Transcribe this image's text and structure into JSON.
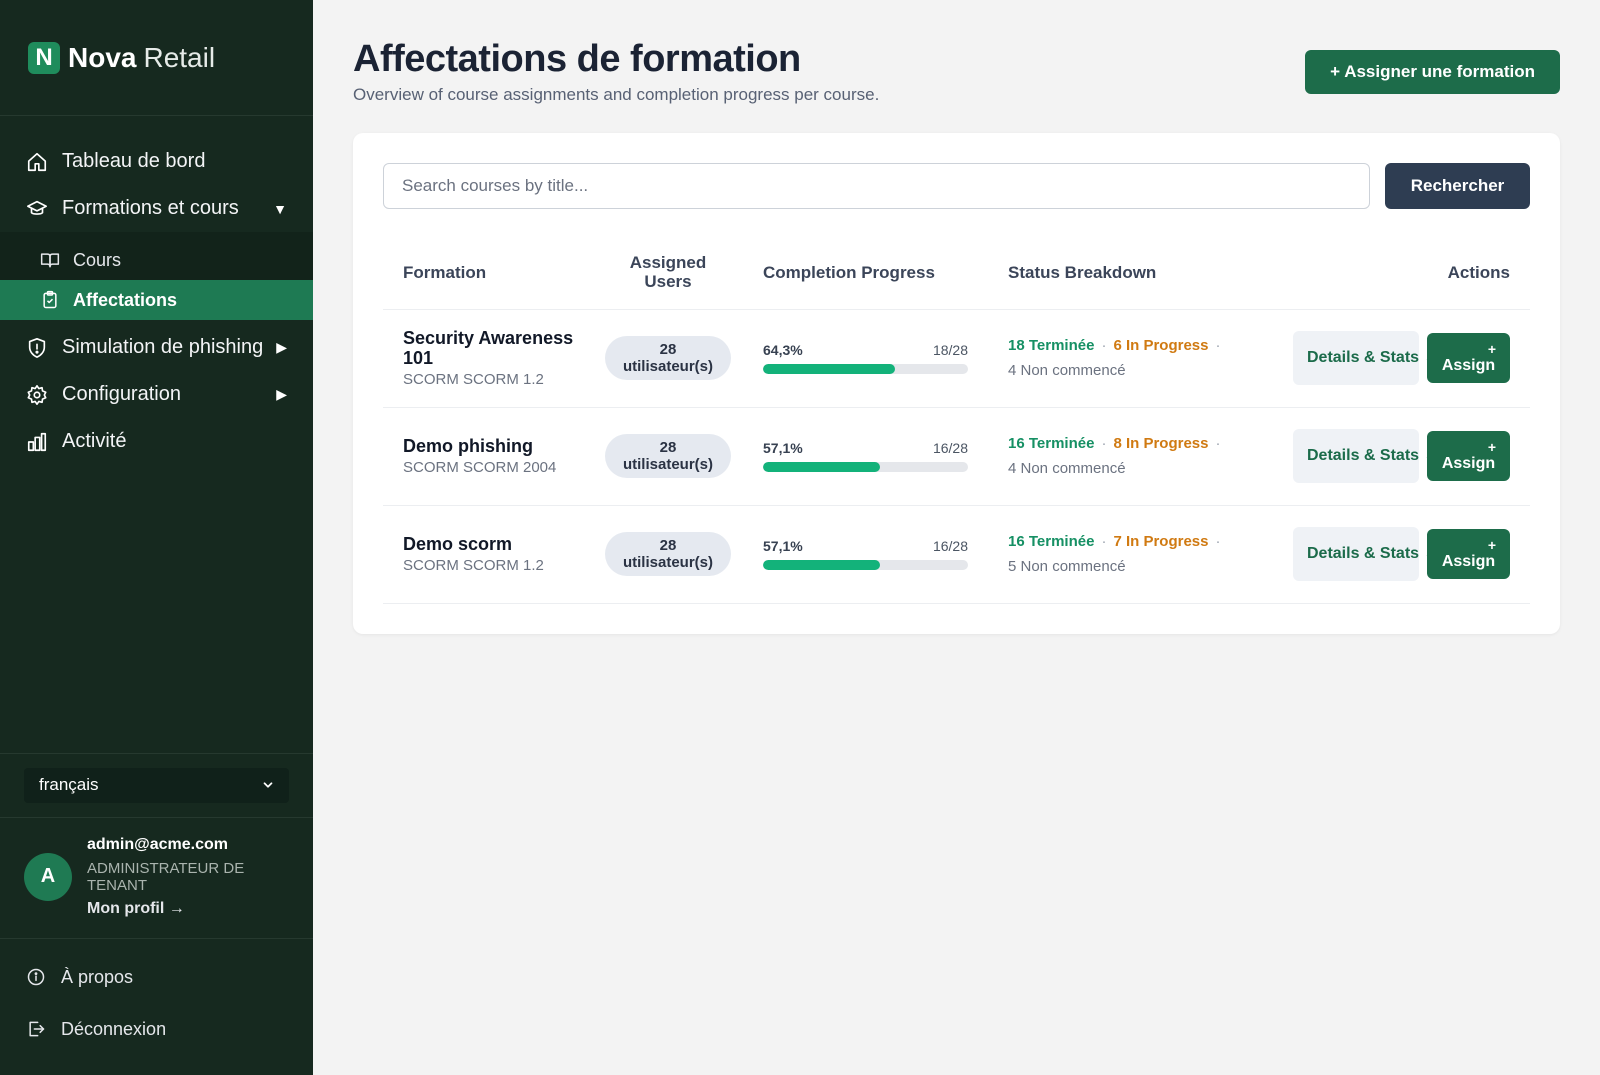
{
  "brand": {
    "logo_letter": "N",
    "name_bold": "Nova",
    "name_light": "Retail"
  },
  "nav": {
    "dashboard": "Tableau de bord",
    "trainings": "Formations et cours",
    "trainings_caret": "▼",
    "sub": {
      "courses": "Cours",
      "assignments": "Affectations"
    },
    "phishing": "Simulation de phishing",
    "phishing_caret": "▶",
    "config": "Configuration",
    "config_caret": "▶",
    "activity": "Activité"
  },
  "language": {
    "selected": "français"
  },
  "user": {
    "initial": "A",
    "email": "admin@acme.com",
    "role": "ADMINISTRATEUR DE TENANT",
    "profile_link": "Mon profil →"
  },
  "footer_nav": {
    "about": "À propos",
    "logout": "Déconnexion"
  },
  "page": {
    "title": "Affectations de formation",
    "subtitle": "Overview of course assignments and completion progress per course.",
    "assign_button": "+ Assigner une formation"
  },
  "search": {
    "placeholder": "Search courses by title...",
    "button": "Rechercher"
  },
  "table": {
    "headers": {
      "formation": "Formation",
      "users_line1": "Assigned",
      "users_line2": "Users",
      "progress": "Completion Progress",
      "status": "Status Breakdown",
      "actions": "Actions"
    },
    "rows": [
      {
        "title": "Security Awareness 101",
        "type": "SCORM SCORM 1.2",
        "users_count": "28",
        "users_label": "utilisateur(s)",
        "percent_label": "64,3%",
        "fraction": "18/28",
        "progress": 0.643,
        "done": "18 Terminée",
        "in_progress": "6 In Progress",
        "not_started": "4 Non commencé",
        "details_label": "Details & Stats →",
        "assign_plus": "+",
        "assign_label": "Assign"
      },
      {
        "title": "Demo phishing",
        "type": "SCORM SCORM 2004",
        "users_count": "28",
        "users_label": "utilisateur(s)",
        "percent_label": "57,1%",
        "fraction": "16/28",
        "progress": 0.571,
        "done": "16 Terminée",
        "in_progress": "8 In Progress",
        "not_started": "4 Non commencé",
        "details_label": "Details & Stats →",
        "assign_plus": "+",
        "assign_label": "Assign"
      },
      {
        "title": "Demo scorm",
        "type": "SCORM SCORM 1.2",
        "users_count": "28",
        "users_label": "utilisateur(s)",
        "percent_label": "57,1%",
        "fraction": "16/28",
        "progress": 0.571,
        "done": "16 Terminée",
        "in_progress": "7 In Progress",
        "not_started": "5 Non commencé",
        "details_label": "Details & Stats →",
        "assign_plus": "+",
        "assign_label": "Assign"
      }
    ]
  },
  "colors": {
    "sidebar_bg": "#16291f",
    "accent": "#1d6c4a",
    "progress_fill": "#13b27a",
    "done": "#169064",
    "in_progress": "#d07a12"
  }
}
